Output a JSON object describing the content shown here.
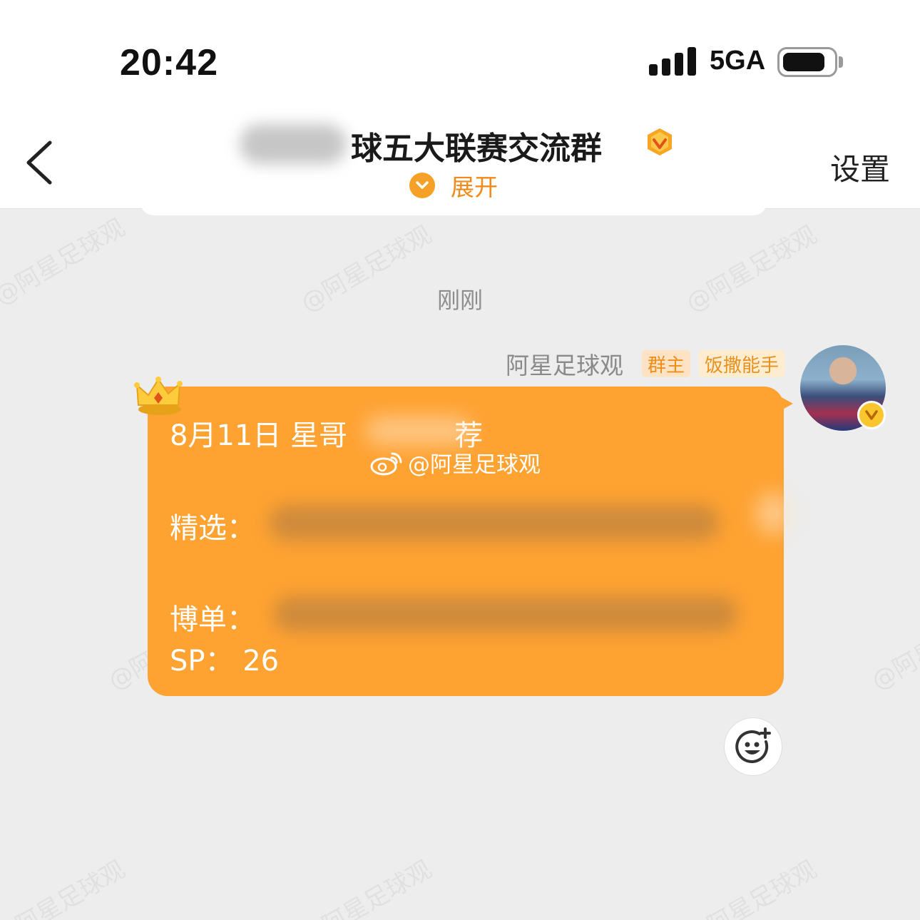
{
  "status_bar": {
    "time": "20:42",
    "network": "5GA",
    "battery_level": 0.85
  },
  "header": {
    "title": "球五大联赛交流群",
    "expand_label": "展开",
    "settings_label": "设置",
    "accent_color": "#f5a026"
  },
  "chat": {
    "timestamp": "刚刚",
    "sender": {
      "name": "阿星足球观",
      "tags": [
        "群主",
        "饭撒能手"
      ]
    },
    "message": {
      "line1_prefix": "8月11日 星哥",
      "line1_suffix": "荐",
      "line2_label": "精选：",
      "line3_label": "博单：",
      "line4": "SP：  26",
      "bubble_color": "#fea232"
    },
    "watermark": "@阿星足球观"
  }
}
